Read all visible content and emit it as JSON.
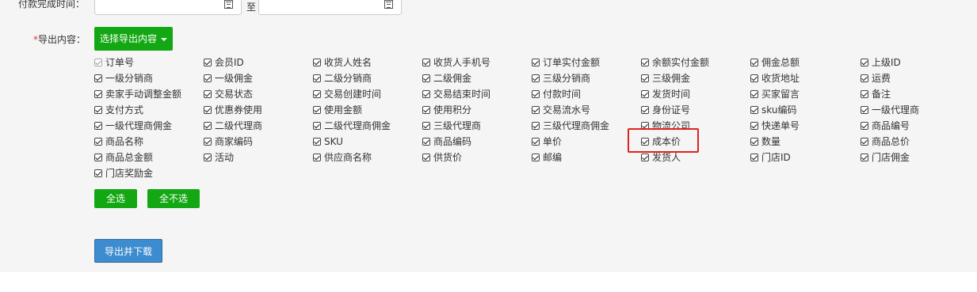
{
  "pay_time": {
    "label": "付款完成时间：",
    "separator": "至",
    "start_value": "",
    "end_value": ""
  },
  "export": {
    "label_required": "*",
    "label": "导出内容：",
    "select_button": "选择导出内容",
    "options": [
      {
        "label": "订单号",
        "checked": true,
        "disabled": true
      },
      {
        "label": "会员ID",
        "checked": true
      },
      {
        "label": "收货人姓名",
        "checked": true
      },
      {
        "label": "收货人手机号",
        "checked": true
      },
      {
        "label": "订单实付金额",
        "checked": true
      },
      {
        "label": "余额实付金额",
        "checked": true
      },
      {
        "label": "佣金总额",
        "checked": true
      },
      {
        "label": "上级ID",
        "checked": true
      },
      {
        "label": "一级分销商",
        "checked": true
      },
      {
        "label": "一级佣金",
        "checked": true
      },
      {
        "label": "二级分销商",
        "checked": true
      },
      {
        "label": "二级佣金",
        "checked": true
      },
      {
        "label": "三级分销商",
        "checked": true
      },
      {
        "label": "三级佣金",
        "checked": true
      },
      {
        "label": "收货地址",
        "checked": true
      },
      {
        "label": "运费",
        "checked": true
      },
      {
        "label": "卖家手动调整金额",
        "checked": true
      },
      {
        "label": "交易状态",
        "checked": true
      },
      {
        "label": "交易创建时间",
        "checked": true
      },
      {
        "label": "交易结束时间",
        "checked": true
      },
      {
        "label": "付款时间",
        "checked": true
      },
      {
        "label": "发货时间",
        "checked": true
      },
      {
        "label": "买家留言",
        "checked": true
      },
      {
        "label": "备注",
        "checked": true
      },
      {
        "label": "支付方式",
        "checked": true
      },
      {
        "label": "优惠券使用",
        "checked": true
      },
      {
        "label": "使用金额",
        "checked": true
      },
      {
        "label": "使用积分",
        "checked": true
      },
      {
        "label": "交易流水号",
        "checked": true
      },
      {
        "label": "身份证号",
        "checked": true
      },
      {
        "label": "sku编码",
        "checked": true
      },
      {
        "label": "一级代理商",
        "checked": true
      },
      {
        "label": "一级代理商佣金",
        "checked": true
      },
      {
        "label": "二级代理商",
        "checked": true
      },
      {
        "label": "二级代理商佣金",
        "checked": true
      },
      {
        "label": "三级代理商",
        "checked": true
      },
      {
        "label": "三级代理商佣金",
        "checked": true
      },
      {
        "label": "物流公司",
        "checked": true
      },
      {
        "label": "快递单号",
        "checked": true
      },
      {
        "label": "商品编号",
        "checked": true
      },
      {
        "label": "商品名称",
        "checked": true
      },
      {
        "label": "商家编码",
        "checked": true
      },
      {
        "label": "SKU",
        "checked": true
      },
      {
        "label": "商品编码",
        "checked": true
      },
      {
        "label": "单价",
        "checked": true
      },
      {
        "label": "成本价",
        "checked": true
      },
      {
        "label": "数量",
        "checked": true
      },
      {
        "label": "商品总价",
        "checked": true
      },
      {
        "label": "商品总金额",
        "checked": true
      },
      {
        "label": "活动",
        "checked": true
      },
      {
        "label": "供应商名称",
        "checked": true
      },
      {
        "label": "供货价",
        "checked": true
      },
      {
        "label": "邮编",
        "checked": true
      },
      {
        "label": "发货人",
        "checked": true
      },
      {
        "label": "门店ID",
        "checked": true
      },
      {
        "label": "门店佣金",
        "checked": true
      },
      {
        "label": "门店奖励金",
        "checked": true
      }
    ],
    "select_all": "全选",
    "select_none": "全不选",
    "submit": "导出并下载"
  },
  "colors": {
    "green": "#13a813",
    "blue": "#3c8ccf",
    "highlight": "#e0221e"
  },
  "icons": {
    "date_picker": "calendar-icon"
  }
}
